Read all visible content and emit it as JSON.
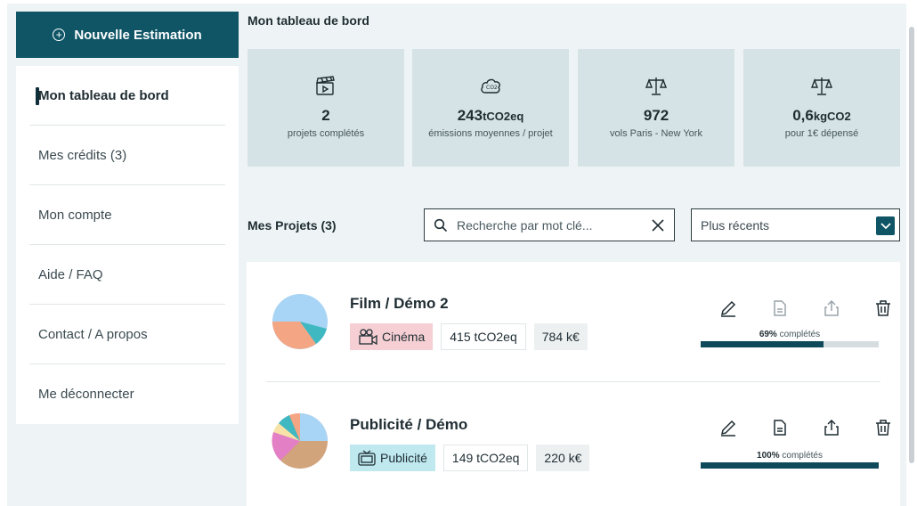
{
  "sidebar": {
    "new_button_label": "Nouvelle Estimation",
    "items": [
      {
        "label": "Mon tableau de bord",
        "active": true
      },
      {
        "label": "Mes crédits (3)"
      },
      {
        "label": "Mon compte"
      },
      {
        "label": "Aide / FAQ"
      },
      {
        "label": "Contact / A propos"
      },
      {
        "label": "Me déconnecter"
      }
    ]
  },
  "header": {
    "title": "Mon tableau de bord"
  },
  "stats": [
    {
      "icon": "clapperboard-icon",
      "value": "2",
      "unit": "",
      "label": "projets complétés"
    },
    {
      "icon": "co2-cloud-icon",
      "value": "243",
      "unit": "tCO2eq",
      "label": "émissions moyennes / projet"
    },
    {
      "icon": "scale-icon",
      "value": "972",
      "unit": "",
      "label": "vols Paris - New York"
    },
    {
      "icon": "scale-icon",
      "value": "0,6",
      "unit": "kgCO2",
      "label": "pour 1€ dépensé"
    }
  ],
  "projects_section": {
    "title": "Mes Projets (3)",
    "search_placeholder": "Recherche par mot clé...",
    "sort_value": "Plus récents"
  },
  "projects": [
    {
      "name": "Film / Démo 2",
      "category": "Cinéma",
      "category_icon": "film-camera-icon",
      "emissions": "415 tCO2eq",
      "budget": "784 k€",
      "progress_value": "69%",
      "progress_suffix": " complétés",
      "progress": 0.69
    },
    {
      "name": "Publicité / Démo",
      "category": "Publicité",
      "category_icon": "tv-icon",
      "emissions": "149 tCO2eq",
      "budget": "220 k€",
      "progress_value": "100%",
      "progress_suffix": " complétés",
      "progress": 1.0
    }
  ],
  "colors": {
    "accent": "#0f5566",
    "card_bg": "#d5e3e6",
    "page_bg": "#eef4f5",
    "cinema_tag": "#f5cfd3",
    "pub_tag": "#bfe9ef",
    "pie_blue": "#a8d4f5",
    "pie_orange": "#f4a583",
    "pie_teal": "#3fb8c1",
    "pie_pink": "#e37fc4",
    "pie_tan": "#d2a47c"
  }
}
